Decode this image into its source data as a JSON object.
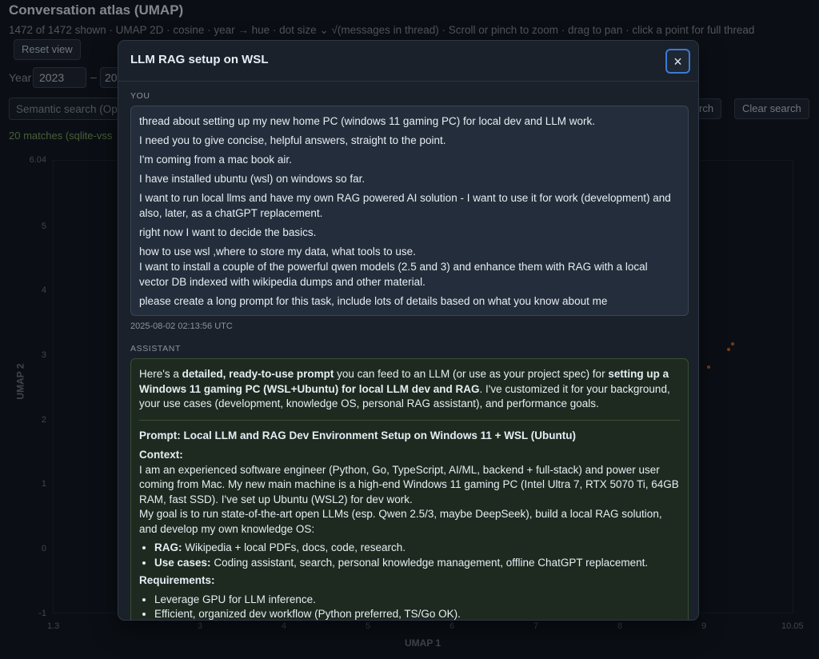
{
  "page": {
    "title": "Conversation atlas (UMAP)",
    "subtitle": "1472 of 1472 shown · UMAP 2D · cosine · year → hue · dot size ⌄ √(messages in thread) · Scroll or pinch to zoom · drag to pan · click a point for full thread",
    "reset_label": "Reset view",
    "year_label": "Year",
    "year_from": "2023",
    "year_dash": "–",
    "year_to": "20",
    "search_placeholder": "Semantic search (Op",
    "search_button": "rch",
    "clear_button": "Clear search",
    "matches_text": "20 matches (sqlite-vss"
  },
  "plot": {
    "y_ticks": [
      "6.04",
      "5",
      "4",
      "3",
      "2",
      "1",
      "0",
      "-1"
    ],
    "x_ticks": [
      "1.3",
      "3",
      "4",
      "5",
      "6",
      "7",
      "8",
      "9",
      "10.05"
    ],
    "x_label": "UMAP 1",
    "y_label": "UMAP 2",
    "highlight_color": "#c66a2a"
  },
  "modal": {
    "title": "LLM RAG setup on WSL",
    "close_label": "×",
    "you_label": "YOU",
    "you_paragraphs": [
      "thread about setting up my new home PC (windows 11 gaming PC) for local dev and LLM work.",
      "I need you to give concise, helpful answers, straight to the point.",
      "I'm coming from a mac book air.",
      "I have installed ubuntu (wsl) on windows so far.",
      "I want to run local llms and have my own RAG powered AI solution - I want to use it for work (development) and also, later, as a chatGPT replacement.",
      "right now I want to decide the basics.",
      "how to use wsl ,where to store my data, what tools to use.\nI want to install a couple of the powerful qwen models (2.5 and 3) and enhance them with RAG with a local vector DB indexed with wikipedia dumps and other material.",
      "please create a long prompt for this task, include lots of details based on what you know about me"
    ],
    "you_timestamp": "2025-08-02 02:13:56 UTC",
    "assistant_label": "ASSISTANT",
    "assistant": {
      "intro_1": "Here's a ",
      "intro_b1": "detailed, ready-to-use prompt",
      "intro_2": " you can feed to an LLM (or use as your project spec) for ",
      "intro_b2": "setting up a Windows 11 gaming PC (WSL+Ubuntu) for local LLM dev and RAG",
      "intro_3": ". I've customized it for your background, your use cases (development, knowledge OS, personal RAG assistant), and performance goals.",
      "prompt_heading": "Prompt: Local LLM and RAG Dev Environment Setup on Windows 11 + WSL (Ubuntu)",
      "context_heading": "Context:",
      "context_text": "I am an experienced software engineer (Python, Go, TypeScript, AI/ML, backend + full-stack) and power user coming from Mac. My new main machine is a high-end Windows 11 gaming PC (Intel Ultra 7, RTX 5070 Ti, 64GB RAM, fast SSD). I've set up Ubuntu (WSL2) for dev work.",
      "goal_text": "My goal is to run state-of-the-art open LLMs (esp. Qwen 2.5/3, maybe DeepSeek), build a local RAG solution, and develop my own knowledge OS:",
      "bullets": [
        {
          "label": "RAG:",
          "text": " Wikipedia + local PDFs, docs, code, research."
        },
        {
          "label": "Use cases:",
          "text": " Coding assistant, search, personal knowledge management, offline ChatGPT replacement."
        }
      ],
      "requirements_heading": "Requirements:",
      "requirements": [
        "Leverage GPU for LLM inference.",
        "Efficient, organized dev workflow (Python preferred, TS/Go OK)."
      ]
    }
  }
}
